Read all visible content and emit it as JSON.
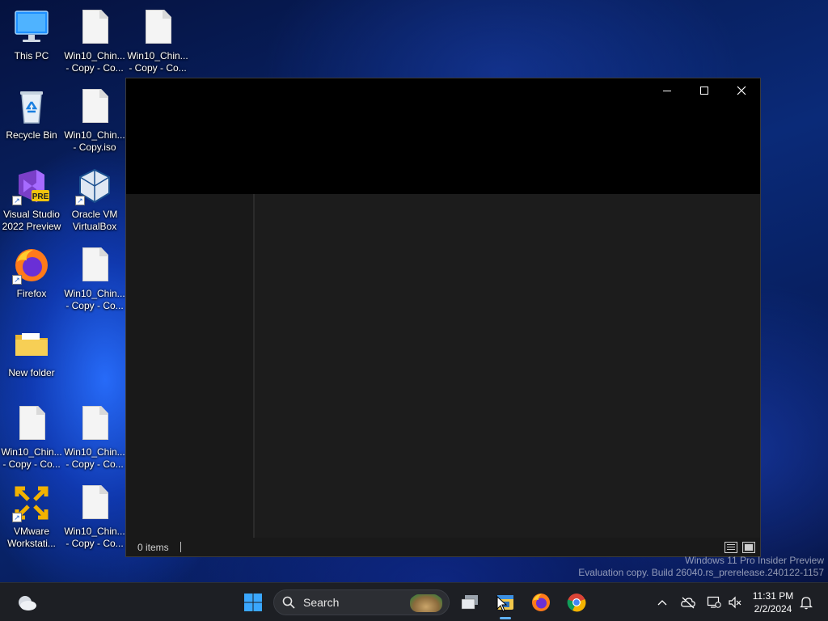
{
  "desktop": {
    "icons": [
      {
        "label": "This PC",
        "icon": "monitor-icon"
      },
      {
        "label": "Win10_Chin...\n- Copy - Co...",
        "icon": "document-icon"
      },
      {
        "label": "Win10_Chin...\n- Copy - Co...",
        "icon": "document-icon"
      },
      {
        "label": "Recycle Bin",
        "icon": "recycle-bin-icon"
      },
      {
        "label": "Win10_Chin...\n- Copy.iso",
        "icon": "document-icon"
      },
      {
        "label": "Visual Studio\n2022 Preview",
        "icon": "visual-studio-icon",
        "badge": "PRE"
      },
      {
        "label": "Oracle VM\nVirtualBox",
        "icon": "virtualbox-icon"
      },
      {
        "label": "Firefox",
        "icon": "firefox-icon"
      },
      {
        "label": "Win10_Chin...\n- Copy - Co...",
        "icon": "document-icon"
      },
      {
        "label": "New folder",
        "icon": "folder-icon"
      },
      {
        "label": "Win10_Chin...\n- Copy - Co...",
        "icon": "document-icon"
      },
      {
        "label": "Win10_Chin...\n- Copy - Co...",
        "icon": "document-icon"
      },
      {
        "label": "VMware\nWorkstati...",
        "icon": "vmware-icon"
      },
      {
        "label": "Win10_Chin...\n- Copy - Co...",
        "icon": "document-icon"
      }
    ]
  },
  "window": {
    "controls": {
      "minimize": "minimize-icon",
      "maximize": "maximize-icon",
      "close": "close-icon"
    },
    "status": {
      "items_count": "0 items"
    }
  },
  "watermark": {
    "line1": "Windows 11 Pro Insider Preview",
    "line2": "Evaluation copy. Build 26040.rs_prerelease.240122-1157"
  },
  "taskbar": {
    "search_label": "Search",
    "clock": {
      "time": "11:31 PM",
      "date": "2/2/2024"
    }
  },
  "colors": {
    "accent": "#0078d4",
    "taskbar": "#1d1f24",
    "window_dark": "#191919"
  }
}
